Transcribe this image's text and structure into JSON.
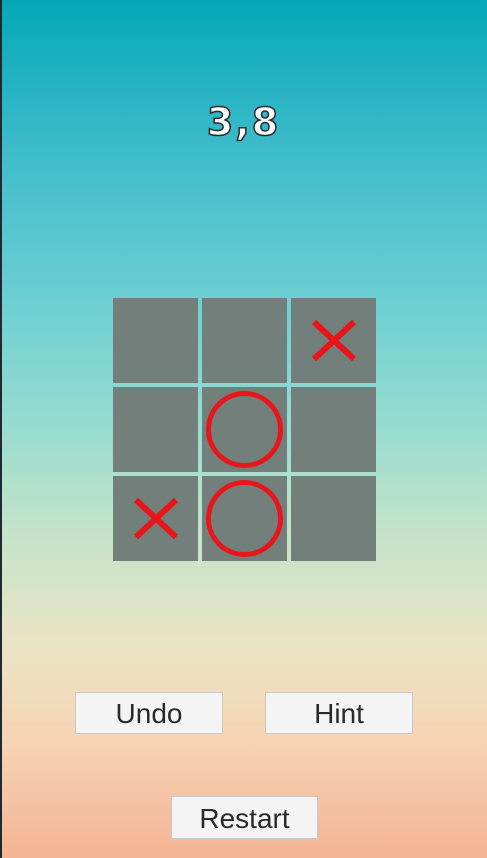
{
  "score": "3,8",
  "board": {
    "cells": [
      "",
      "",
      "X",
      "",
      "O",
      "",
      "X",
      "O",
      ""
    ],
    "mark_color": "#e8161a",
    "cell_color": "#727f7a"
  },
  "buttons": {
    "undo_label": "Undo",
    "hint_label": "Hint",
    "restart_label": "Restart"
  }
}
